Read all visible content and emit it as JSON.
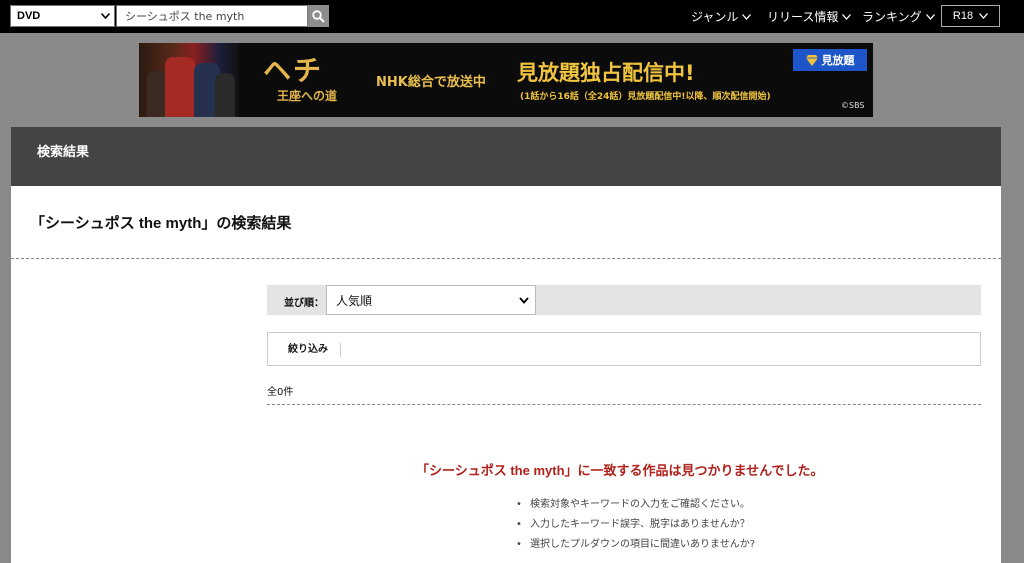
{
  "topbar": {
    "category_value": "DVD",
    "search_value": "シーシュポス the myth",
    "nav": [
      {
        "label": "ジャンル"
      },
      {
        "label": "リリース情報"
      },
      {
        "label": "ランキング"
      }
    ],
    "r18_label": "R18"
  },
  "banner": {
    "logo_text": "ヘチ",
    "logo_sub": "王座への道",
    "broadcast": "NHK総合で放送中",
    "headline": "見放題独占配信中!",
    "detail": "(1話から16話（全24話）見放題配信中!以降、順次配信開始)",
    "badge": "見放題",
    "copyright": "©SBS"
  },
  "panel": {
    "header_title": "検索結果",
    "result_title": "「シーシュポス the myth」の検索結果",
    "sort_label": "並び順：",
    "sort_value": "人気順",
    "filter_label": "絞り込み",
    "count": "全0件",
    "not_found": "「シーシュポス the myth」に一致する作品は見つかりませんでした。",
    "tips": [
      "検索対象やキーワードの入力をご確認ください。",
      "入力したキーワード誤字、脱字はありませんか？",
      "選択したプルダウンの項目に間違いありませんか?"
    ]
  },
  "colors": {
    "topbar_bg": "#000000",
    "panel_header_bg": "#444444",
    "error_text": "#b0211b",
    "banner_gold": "#f0c43f",
    "badge_blue": "#1e56c9"
  }
}
